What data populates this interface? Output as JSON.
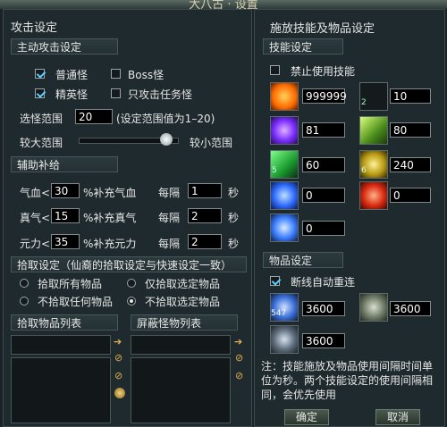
{
  "window": {
    "title": "大八古 · 设置"
  },
  "left": {
    "heading": "攻击设定",
    "attack": {
      "section_title": "主动攻击设定",
      "normal": "普通怪",
      "boss": "Boss怪",
      "elite": "精英怪",
      "task_only": "只攻击任务怪",
      "range_label": "选怪范围",
      "range_value": "20",
      "range_hint": "(设定范围值为1–20)",
      "larger": "较大范围",
      "smaller": "较小范围",
      "slider_level": 0.95
    },
    "assist": {
      "section_title": "辅助补给",
      "rows": [
        {
          "label": "气血<",
          "value": "30",
          "desc": "%补充气血",
          "every": "每隔",
          "interval": "1",
          "unit": "秒"
        },
        {
          "label": "真气<",
          "value": "15",
          "desc": "%补充真气",
          "every": "每隔",
          "interval": "2",
          "unit": "秒"
        },
        {
          "label": "元力<",
          "value": "35",
          "desc": "%补充元力",
          "every": "每隔",
          "interval": "2",
          "unit": "秒"
        }
      ]
    },
    "pickup": {
      "section_title": "拾取设定（仙裔的拾取设定与快速设定一致）",
      "pick_all": "拾取所有物品",
      "pick_selected": "仅拾取选定物品",
      "pick_none": "不拾取任何物品",
      "not_pick_selected": "不拾取选定物品"
    },
    "lists": {
      "pickup_list": "拾取物品列表",
      "block_list": "屏蔽怪物列表"
    }
  },
  "right": {
    "heading": "施放技能及物品设定",
    "skill_section": "技能设定",
    "disable_skills": "禁止使用技能",
    "skills": [
      {
        "value": "999999",
        "color": "#ff8a1e"
      },
      {
        "value": "10",
        "color": "#2a2f31",
        "badge": "2"
      },
      {
        "value": "81",
        "color": "#8a4dff"
      },
      {
        "value": "80",
        "color": "#7fc23a"
      },
      {
        "value": "60",
        "color": "#2fc24a",
        "badge": "5"
      },
      {
        "value": "240",
        "color": "#c2b01a",
        "badge": "6"
      },
      {
        "value": "0",
        "color": "#2e7dff"
      },
      {
        "value": "0",
        "color": "#e83a1e"
      },
      {
        "value": "0",
        "color": "#4a8dff"
      }
    ],
    "item_section": "物品设定",
    "reconnect": "断线自动重连",
    "items": [
      {
        "value": "3600",
        "badge": "547",
        "color": "#3a6fd8"
      },
      {
        "value": "3600",
        "color": "#6f7a66"
      },
      {
        "value": "3600",
        "color": "#5d6b7a"
      }
    ],
    "note": "注：技能施放及物品使用间隔时间单位为秒。两个技能设定的使用间隔相同，会优先使用",
    "confirm": "确定",
    "cancel": "取消"
  }
}
